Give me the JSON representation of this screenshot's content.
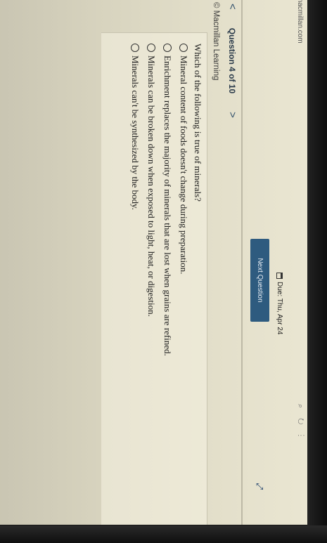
{
  "browser": {
    "url_fragment": "macmillan.com",
    "icons": [
      "zoom-icon",
      "refresh-icon",
      "menu-icon"
    ]
  },
  "header": {
    "due_label": "Due: Thu, Apr 24",
    "next_button": "Next Question",
    "expand_icon": "expand-icon"
  },
  "nav": {
    "prev": "<",
    "question_label": "Question 4 of 10",
    "next": ">"
  },
  "copyright": "© Macmillan Learning",
  "question": {
    "prompt": "Which of the following is true of minerals?",
    "options": [
      "Mineral content of foods doesn't change during preparation.",
      "Enrichment replaces the majority of minerals that are lost when grains are refined.",
      "Minerals can be broken down when exposed to light, heat, or digestion.",
      "Minerals can't be synthesized by the body."
    ],
    "selected": null
  },
  "colors": {
    "button": "#2e5b7f",
    "accent_text": "#2f4f6b"
  }
}
